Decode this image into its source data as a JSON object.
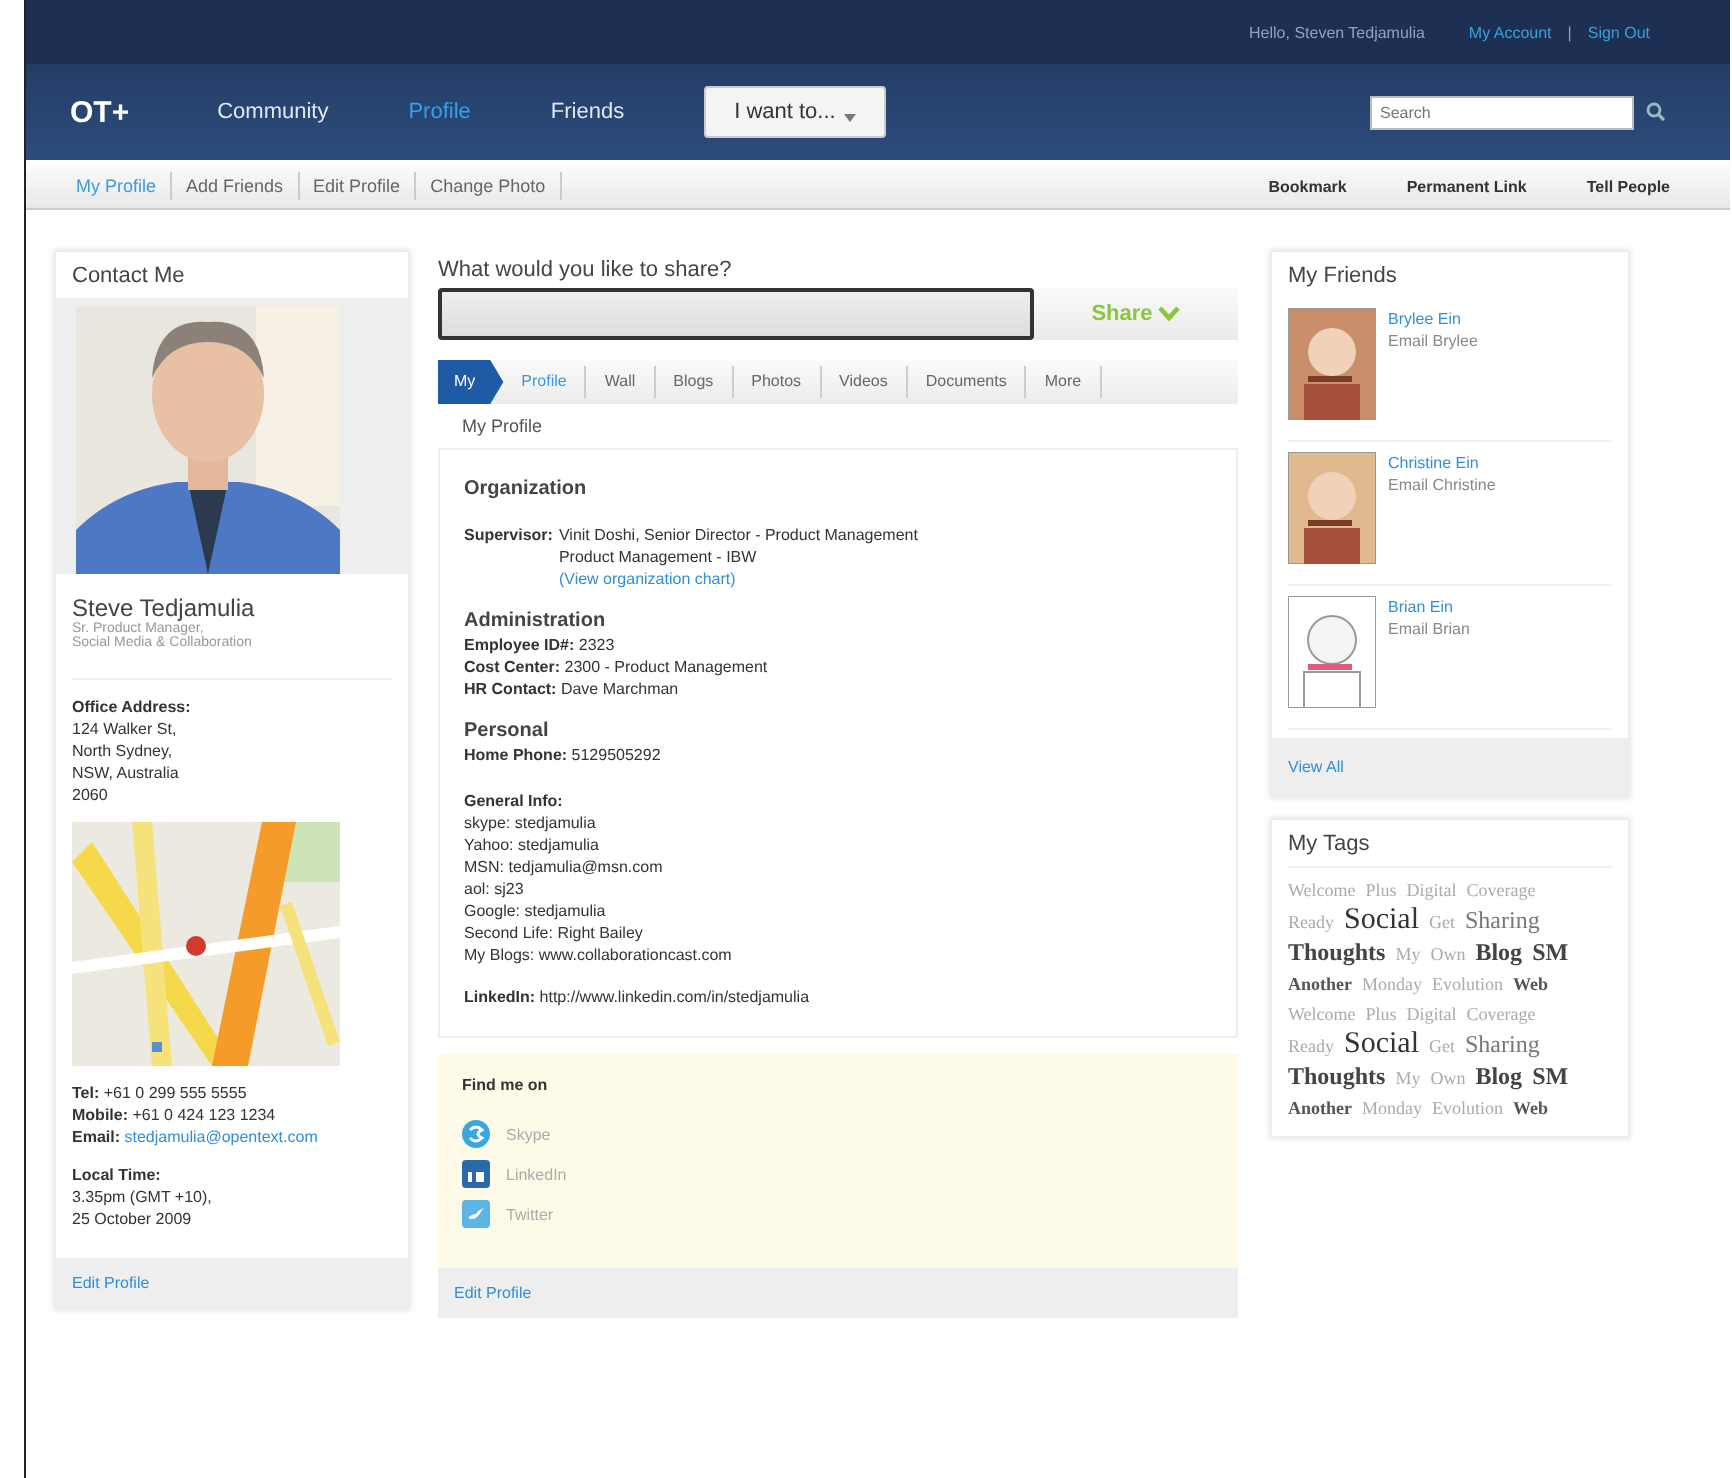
{
  "top_bar": {
    "greeting": "Hello, Steven Tedjamulia",
    "links": [
      "My Account",
      "Sign Out"
    ],
    "separator": "|"
  },
  "header": {
    "logo": "OT+",
    "nav": [
      {
        "label": "Community",
        "selected": false
      },
      {
        "label": "Profile",
        "selected": true
      },
      {
        "label": "Friends",
        "selected": false
      }
    ],
    "action_button": "I want to...",
    "search": {
      "placeholder": "Search"
    }
  },
  "sub_nav": {
    "items": [
      {
        "label": "My Profile",
        "selected": true
      },
      {
        "label": "Add Friends",
        "selected": false
      },
      {
        "label": "Edit Profile",
        "selected": false
      },
      {
        "label": "Change Photo",
        "selected": false
      }
    ],
    "actions": [
      "Bookmark",
      "Permanent Link",
      "Tell People"
    ]
  },
  "contact": {
    "title": "Contact Me",
    "name": "Steve Tedjamulia",
    "job_lines": [
      "Sr. Product Manager,",
      "Social Media & Collaboration"
    ],
    "address_label": "Office Address:",
    "address_lines": [
      "124 Walker St,",
      "North Sydney,",
      "NSW, Australia",
      "2060"
    ],
    "tel_label": "Tel:",
    "tel": "+61 0 299 555 5555",
    "mobile_label": "Mobile:",
    "mobile": "+61 0 424 123 1234",
    "email_label": "Email:",
    "email": "stedjamulia@opentext.com",
    "time_label": "Local Time:",
    "time_lines": [
      "3.35pm (GMT +10),",
      "25 October 2009"
    ],
    "footer_link": "Edit Profile"
  },
  "share": {
    "prompt": "What would you like to share?",
    "button": "Share"
  },
  "tabs": {
    "lead": "My",
    "items": [
      {
        "label": "Profile",
        "selected": true
      },
      {
        "label": "Wall",
        "selected": false
      },
      {
        "label": "Blogs",
        "selected": false
      },
      {
        "label": "Photos",
        "selected": false
      },
      {
        "label": "Videos",
        "selected": false
      },
      {
        "label": "Documents",
        "selected": false
      },
      {
        "label": "More",
        "selected": false
      }
    ]
  },
  "profile": {
    "title": "My Profile",
    "organization_heading": "Organization",
    "supervisor_label": "Supervisor:",
    "supervisor_lines": [
      "Vinit Doshi, Senior Director - Product Management",
      "Product Management - IBW"
    ],
    "org_chart_link": "(View organization chart)",
    "administration_heading": "Administration",
    "administration": [
      {
        "label": "Employee ID#:",
        "value": "2323"
      },
      {
        "label": "Cost Center:",
        "value": "2300 - Product Management"
      },
      {
        "label": "HR Contact:",
        "value": "Dave Marchman"
      }
    ],
    "personal_heading": "Personal",
    "personal": [
      {
        "label": "Home Phone:",
        "value": "5129505292"
      }
    ],
    "general_heading": "General Info:",
    "general_lines": [
      "skype: stedjamulia",
      "Yahoo: stedjamulia",
      "MSN: tedjamulia@msn.com",
      "aol: sj23",
      "Google: stedjamulia",
      "Second Life: Right Bailey",
      "My Blogs: www.collaborationcast.com"
    ],
    "linkedin_label": "LinkedIn:",
    "linkedin": "http://www.linkedin.com/in/stedjamulia"
  },
  "find_me": {
    "title": "Find me on",
    "services": [
      {
        "kind": "skype",
        "label": "Skype"
      },
      {
        "kind": "linkedin",
        "label": "LinkedIn"
      },
      {
        "kind": "twitter",
        "label": "Twitter"
      }
    ],
    "footer_link": "Edit Profile"
  },
  "friends": {
    "title": "My Friends",
    "items": [
      {
        "name": "Brylee Ein",
        "email": "Email Brylee"
      },
      {
        "name": "Christine Ein",
        "email": "Email Christine"
      },
      {
        "name": "Brian Ein",
        "email": "Email Brian"
      }
    ],
    "footer_link": "View All"
  },
  "tags": {
    "title": "My Tags",
    "rows": [
      [
        {
          "label": "Welcome",
          "kind": "faint"
        },
        {
          "label": "Plus",
          "kind": "faint"
        },
        {
          "label": "Digital",
          "kind": "faint"
        },
        {
          "label": "Coverage",
          "kind": "faint"
        }
      ],
      [
        {
          "label": "Ready",
          "kind": "faint"
        },
        {
          "label": "Social",
          "kind": "big"
        },
        {
          "label": "Get",
          "kind": "faint"
        },
        {
          "label": "Sharing",
          "kind": "medium"
        }
      ],
      [
        {
          "label": "Thoughts",
          "kind": "bold"
        },
        {
          "label": "My",
          "kind": "faint"
        },
        {
          "label": "Own",
          "kind": "faint"
        },
        {
          "label": "Blog",
          "kind": "bold"
        },
        {
          "label": "SM",
          "kind": "bold"
        }
      ],
      [
        {
          "label": "Another",
          "kind": "dark"
        },
        {
          "label": "Monday",
          "kind": "faint"
        },
        {
          "label": "Evolution",
          "kind": "faint"
        },
        {
          "label": "Web",
          "kind": "dark"
        }
      ],
      [
        {
          "label": "Welcome",
          "kind": "faint"
        },
        {
          "label": "Plus",
          "kind": "faint"
        },
        {
          "label": "Digital",
          "kind": "faint"
        },
        {
          "label": "Coverage",
          "kind": "faint"
        }
      ],
      [
        {
          "label": "Ready",
          "kind": "faint"
        },
        {
          "label": "Social",
          "kind": "big"
        },
        {
          "label": "Get",
          "kind": "faint"
        },
        {
          "label": "Sharing",
          "kind": "medium"
        }
      ],
      [
        {
          "label": "Thoughts",
          "kind": "bold"
        },
        {
          "label": "My",
          "kind": "faint"
        },
        {
          "label": "Own",
          "kind": "faint"
        },
        {
          "label": "Blog",
          "kind": "bold"
        },
        {
          "label": "SM",
          "kind": "bold"
        }
      ],
      [
        {
          "label": "Another",
          "kind": "dark"
        },
        {
          "label": "Monday",
          "kind": "faint"
        },
        {
          "label": "Evolution",
          "kind": "faint"
        },
        {
          "label": "Web",
          "kind": "dark"
        }
      ]
    ]
  }
}
